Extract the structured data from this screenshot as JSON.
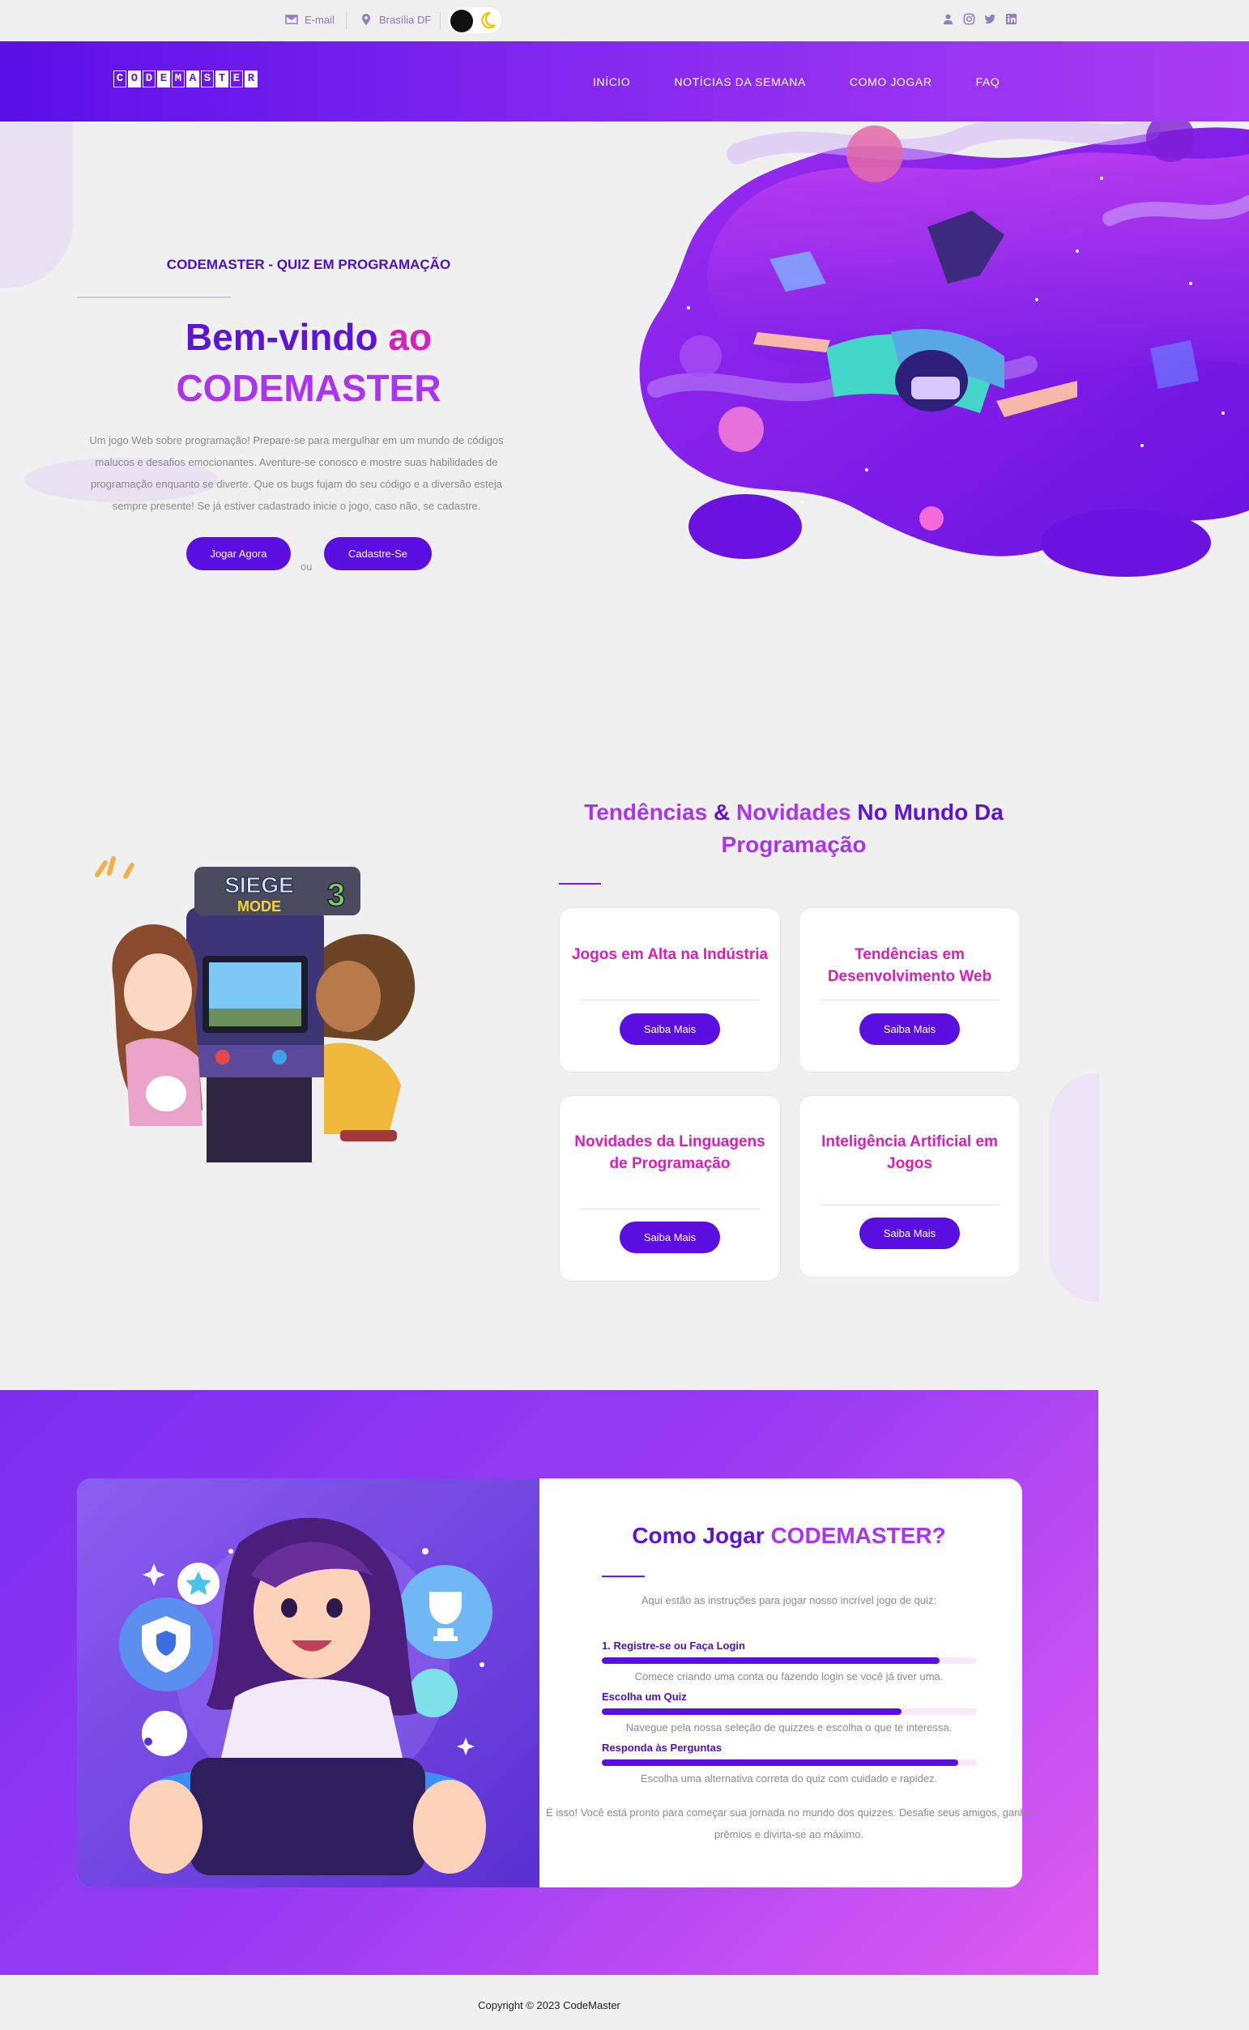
{
  "topbar": {
    "email_label": "E-mail",
    "location_label": "Brasília DF",
    "icons": [
      "envelope-icon",
      "map-pin-icon",
      "moon-icon",
      "user-icon",
      "instagram-icon",
      "twitter-icon",
      "linkedin-icon"
    ]
  },
  "nav": {
    "logo_letters": [
      "C",
      "O",
      "D",
      "E",
      "M",
      "A",
      "S",
      "T",
      "E",
      "R"
    ],
    "links": [
      "INÍCIO",
      "NOTÍCIAS DA SEMANA",
      "COMO JOGAR",
      "FAQ"
    ]
  },
  "hero": {
    "eyebrow": "CODEMASTER - QUIZ EM PROGRAMAÇÃO",
    "title_part1": "Bem-vindo",
    "title_part2": "ao",
    "title_part3": "CODEMASTER",
    "description": "Um jogo Web sobre programação! Prepare-se para mergulhar em um mundo de códigos malucos e desafios emocionantes. Aventure-se conosco e mostre suas habilidades de programação enquanto se diverte. Que os bugs fujam do seu código e a diversão esteja sempre presente! Se já estiver cadastrado inicie o jogo, caso não, se cadastre.",
    "play_button": "Jogar Agora",
    "or_text": "ou",
    "register_button": "Cadastre-Se"
  },
  "trends": {
    "title_part1": "Tendências",
    "title_part2": "&",
    "title_part3": "Novidades",
    "title_part4": "No Mundo Da",
    "title_part5": "Programação",
    "illustration_logo_top": "SIEGE",
    "illustration_logo_bottom": "MODE",
    "illustration_logo_number": "3",
    "cards": [
      {
        "title": "Jogos em Alta na Indústria",
        "button": "Saiba Mais"
      },
      {
        "title": "Tendências em Desenvolvimento Web",
        "button": "Saiba Mais"
      },
      {
        "title": "Novidades da Linguagens de Programação",
        "button": "Saiba Mais"
      },
      {
        "title": "Inteligência Artificial em Jogos",
        "button": "Saiba Mais"
      }
    ]
  },
  "how": {
    "title_part1": "Como Jogar",
    "title_part2": "CODEMASTER?",
    "intro": "Aqui estão as instruções para jogar nosso incrível jogo de quiz:",
    "steps": [
      {
        "label": "1. Registre-se ou Faça Login",
        "progress": 0.9,
        "desc": "Comece criando uma conta ou fazendo login se você já tiver uma."
      },
      {
        "label": "Escolha um Quiz",
        "progress": 0.8,
        "desc": "Navegue pela nossa seleção de quizzes e escolha o que te interessa."
      },
      {
        "label": "Responda às Perguntas",
        "progress": 0.95,
        "desc": "Escolha uma alternativa correta do quiz com cuidado e rapidez."
      }
    ],
    "outro": "É isso! Você está pronto para começar sua jornada no mundo dos quizzes. Desafie seus amigos, ganhe prêmios e divirta-se ao máximo."
  },
  "footer": {
    "copyright": "Copyright © 2023 CodeMaster"
  },
  "colors": {
    "primary": "#5a0fe0",
    "pink": "#d61fbb",
    "violet": "#ab34ee",
    "background": "#f0f0f0"
  }
}
